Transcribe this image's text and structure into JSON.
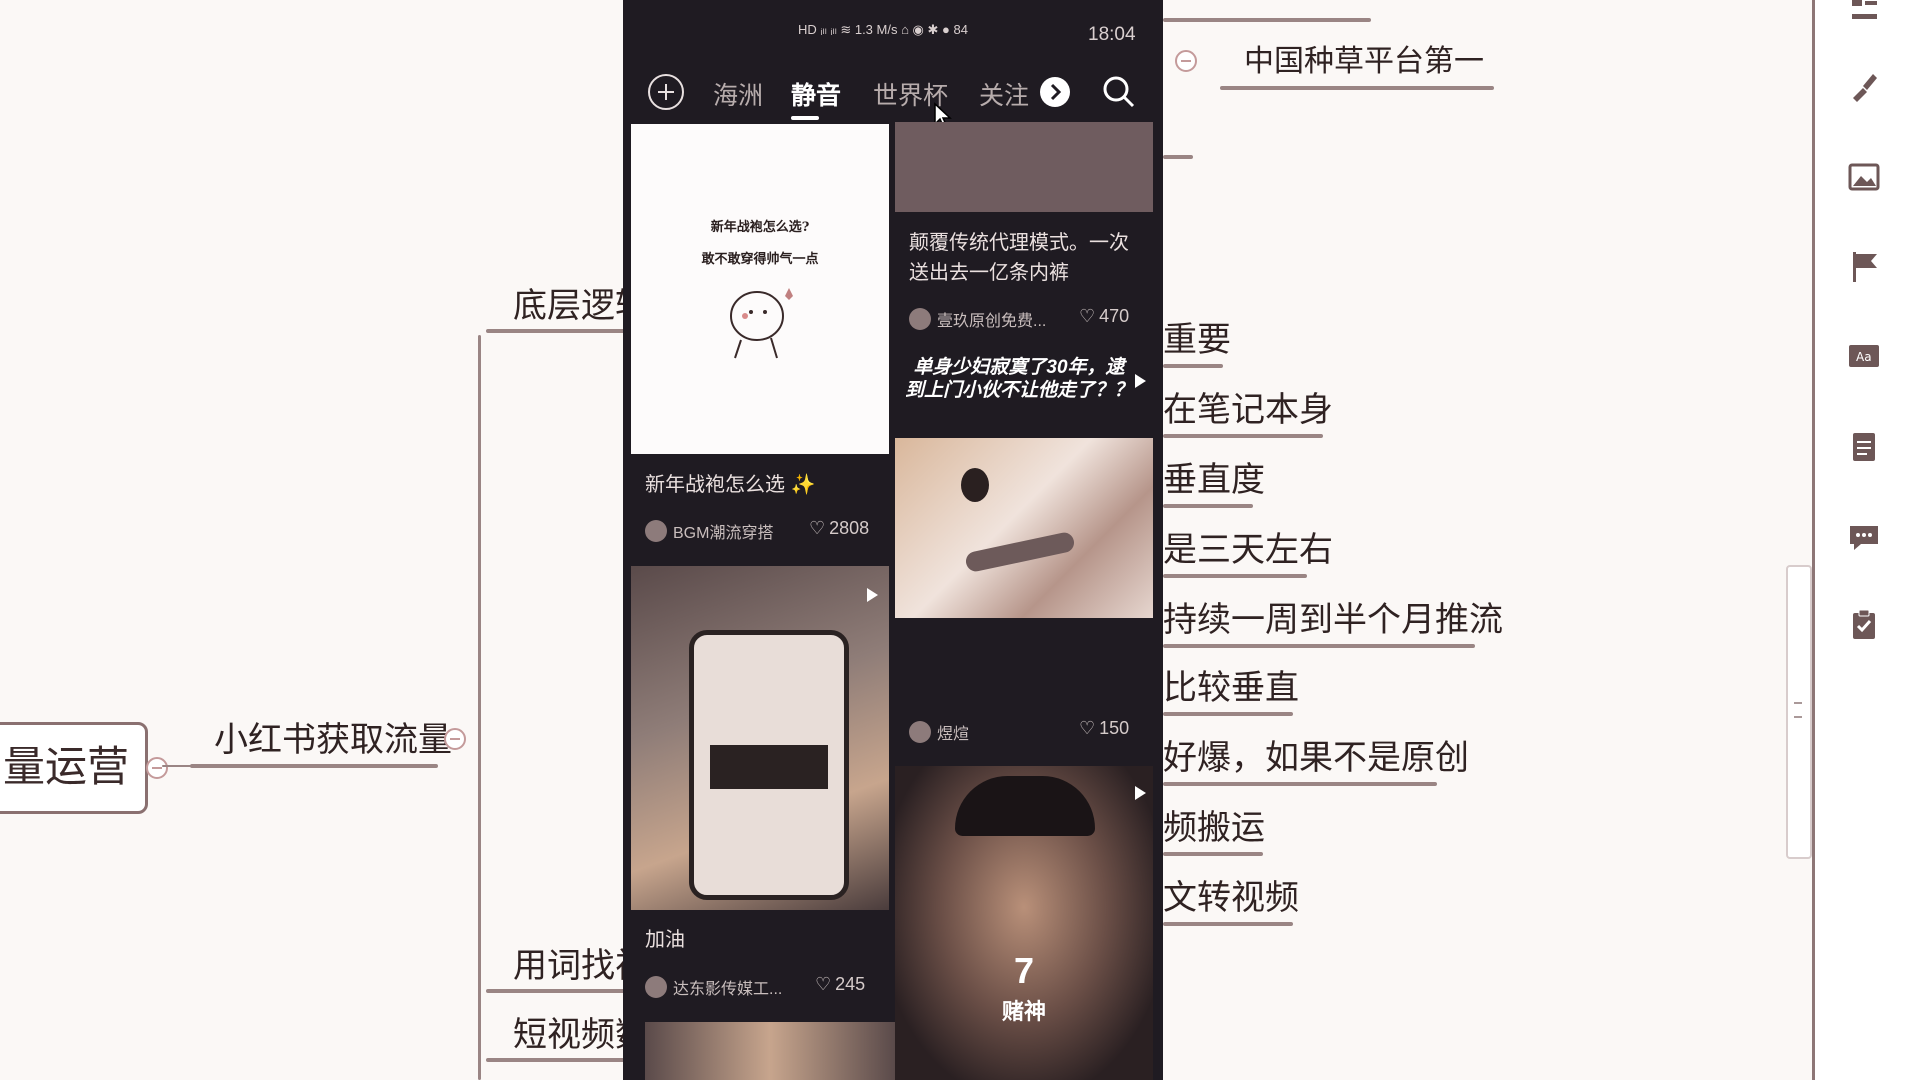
{
  "mindmap": {
    "root": "量运营",
    "main_branch": "小红书获取流量",
    "left_nodes": [
      "底层逻辑",
      "用词找视",
      "短视频数"
    ],
    "right_nodes": [
      "中国种草平台第一",
      "重要",
      "在笔记本身",
      "垂直度",
      "是三天左右",
      "持续一周到半个月推流",
      "比较垂直",
      "好爆，如果不是原创",
      "频搬运",
      "文转视频"
    ]
  },
  "phone": {
    "status_time": "18:04",
    "status_icons": "HD ᵢₗₗ ᵢₗₗ ≋ 1.3 M/s ⌂ ◉ ✱ ● 84",
    "tabs": [
      "海洲",
      "静音",
      "世界杯",
      "关注"
    ],
    "feed": {
      "card1_image_line1": "新年战袍怎么选?",
      "card1_image_line2": "敢不敢穿得帅气一点",
      "card1_title": "新年战袍怎么选 ✨",
      "card1_author": "BGM潮流穿搭",
      "card1_likes": "2808",
      "card2_title": "颠覆传统代理模式。一次送出去一亿条内裤",
      "card2_author": "壹玖原创免费...",
      "card2_likes": "470",
      "card3_overlay": "单身少妇寂寞了30年，逮到上门小伙不让他走了？？",
      "card4_title": "加油",
      "card4_author": "达东影传媒工...",
      "card4_likes": "245",
      "card5_author": "煜煊",
      "card5_likes": "150",
      "card6_overlay_num": "7",
      "card6_overlay_text": "赌神"
    }
  }
}
